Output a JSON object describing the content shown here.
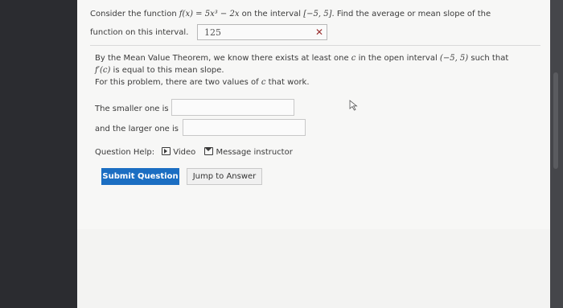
{
  "question": {
    "part1_prefix": "Consider the function ",
    "function_expr": "f(x) = 5x³ − 2x",
    "part1_mid": " on the interval ",
    "interval": "[−5, 5]",
    "part1_suffix": ". Find the average or mean slope of the",
    "part2_text": "function on this interval.",
    "answer_value": "125",
    "answer_status_icon": "incorrect-x-icon"
  },
  "mvt": {
    "line1_prefix": "By the Mean Value Theorem, we know there exists at least one ",
    "c_var": "c",
    "line1_mid": " in the open interval ",
    "open_interval": "(−5, 5)",
    "line1_suffix": " such that",
    "line2_expr": "f′(c)",
    "line2_suffix": " is equal to this mean slope.",
    "line3_prefix": "For this problem, there are two values of ",
    "line3_c": "c",
    "line3_suffix": " that work."
  },
  "inputs": {
    "smaller_label": "The smaller one is",
    "smaller_value": "",
    "larger_label": "and the larger one is",
    "larger_value": ""
  },
  "help": {
    "label": "Question Help:",
    "video_label": "Video",
    "message_label": "Message instructor"
  },
  "buttons": {
    "submit": "Submit Question",
    "jump": "Jump to Answer"
  },
  "colors": {
    "accent": "#1b6ec2",
    "error": "#9a3030",
    "background": "#2b2c30",
    "card": "#f7f7f6"
  }
}
